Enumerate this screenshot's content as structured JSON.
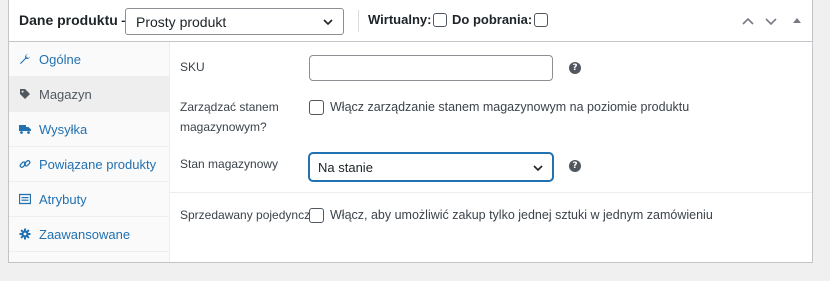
{
  "header": {
    "title": "Dane produktu —",
    "product_type": "Prosty produkt",
    "virtual_label": "Wirtualny:",
    "download_label": "Do pobrania:"
  },
  "tabs": [
    {
      "label": "Ogólne",
      "icon": "wrench-icon",
      "active": false
    },
    {
      "label": "Magazyn",
      "icon": "tag-icon",
      "active": true
    },
    {
      "label": "Wysyłka",
      "icon": "truck-icon",
      "active": false
    },
    {
      "label": "Powiązane produkty",
      "icon": "link-icon",
      "active": false
    },
    {
      "label": "Atrybuty",
      "icon": "list-icon",
      "active": false
    },
    {
      "label": "Zaawansowane",
      "icon": "gear-icon",
      "active": false
    }
  ],
  "inventory": {
    "sku_label": "SKU",
    "sku_value": "",
    "manage_stock_label_line1": "Zarządzać stanem",
    "manage_stock_label_line2": "magazynowym?",
    "manage_stock_text": "Włącz zarządzanie stanem magazynowym na poziomie produktu",
    "stock_status_label": "Stan magazynowy",
    "stock_status_value": "Na stanie",
    "sold_individually_label": "Sprzedawany pojedynczo",
    "sold_individually_text": "Włącz, aby umożliwić zakup tylko jednej sztuki w jednym zamówieniu"
  },
  "colors": {
    "link": "#2271b1",
    "active_tab_bg": "#eeeeee",
    "focus_border": "#2271b1"
  }
}
